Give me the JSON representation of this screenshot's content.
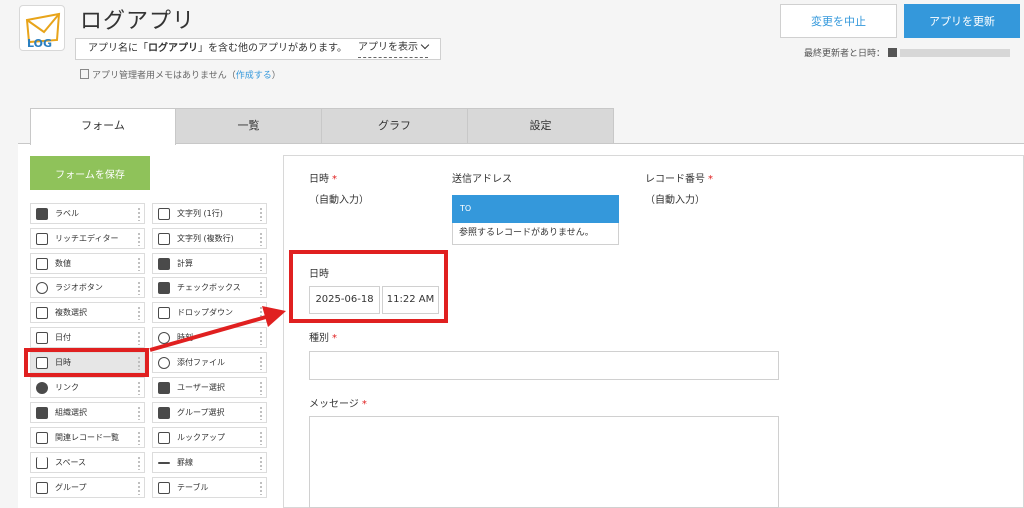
{
  "header": {
    "app_icon_text": "LOG",
    "app_title": "ログアプリ",
    "notice_prefix": "アプリ名に「",
    "notice_name": "ログアプリ",
    "notice_suffix": "」を含む他のアプリがあります。",
    "notice_show": "アプリを表示",
    "memo_text": "アプリ管理者用メモはありません（",
    "memo_link": "作成する",
    "memo_close": "）",
    "cancel_label": "変更を中止",
    "update_label": "アプリを更新",
    "updater_label": "最終更新者と日時："
  },
  "tabs": [
    {
      "label": "フォーム",
      "active": true
    },
    {
      "label": "一覧",
      "active": false
    },
    {
      "label": "グラフ",
      "active": false
    },
    {
      "label": "設定",
      "active": false
    }
  ],
  "save_form_label": "フォームを保存",
  "palette": {
    "left": [
      {
        "label": "ラベル",
        "icon": "tag-icon"
      },
      {
        "label": "リッチエディター",
        "icon": "rich-editor-icon"
      },
      {
        "label": "数値",
        "icon": "number-icon"
      },
      {
        "label": "ラジオボタン",
        "icon": "radio-icon"
      },
      {
        "label": "複数選択",
        "icon": "multi-select-icon"
      },
      {
        "label": "日付",
        "icon": "calendar-icon"
      },
      {
        "label": "日時",
        "icon": "datetime-icon"
      },
      {
        "label": "リンク",
        "icon": "globe-icon"
      },
      {
        "label": "組織選択",
        "icon": "org-icon"
      },
      {
        "label": "関連レコード一覧",
        "icon": "related-records-icon"
      },
      {
        "label": "スペース",
        "icon": "space-icon"
      },
      {
        "label": "グループ",
        "icon": "group-icon"
      }
    ],
    "right": [
      {
        "label": "文字列 (1行)",
        "icon": "text-single-icon"
      },
      {
        "label": "文字列 (複数行)",
        "icon": "text-multi-icon"
      },
      {
        "label": "計算",
        "icon": "calculator-icon"
      },
      {
        "label": "チェックボックス",
        "icon": "checkbox-icon"
      },
      {
        "label": "ドロップダウン",
        "icon": "dropdown-icon"
      },
      {
        "label": "時刻",
        "icon": "clock-icon"
      },
      {
        "label": "添付ファイル",
        "icon": "paperclip-icon"
      },
      {
        "label": "ユーザー選択",
        "icon": "user-icon"
      },
      {
        "label": "グループ選択",
        "icon": "users-icon"
      },
      {
        "label": "ルックアップ",
        "icon": "lookup-icon"
      },
      {
        "label": "罫線",
        "icon": "line-icon"
      },
      {
        "label": "テーブル",
        "icon": "table-icon"
      }
    ]
  },
  "form": {
    "datetime_label": "日時",
    "auto_input": "（自動入力）",
    "address_label": "送信アドレス",
    "ref_head": "TO",
    "ref_body": "参照するレコードがありません。",
    "record_no_label": "レコード番号",
    "record_auto": "（自動入力）",
    "new_datetime_label": "日時",
    "date_value": "2025-06-18",
    "time_value": "11:22 AM",
    "type_label": "種別",
    "message_label": "メッセージ",
    "required_mark": "*"
  }
}
